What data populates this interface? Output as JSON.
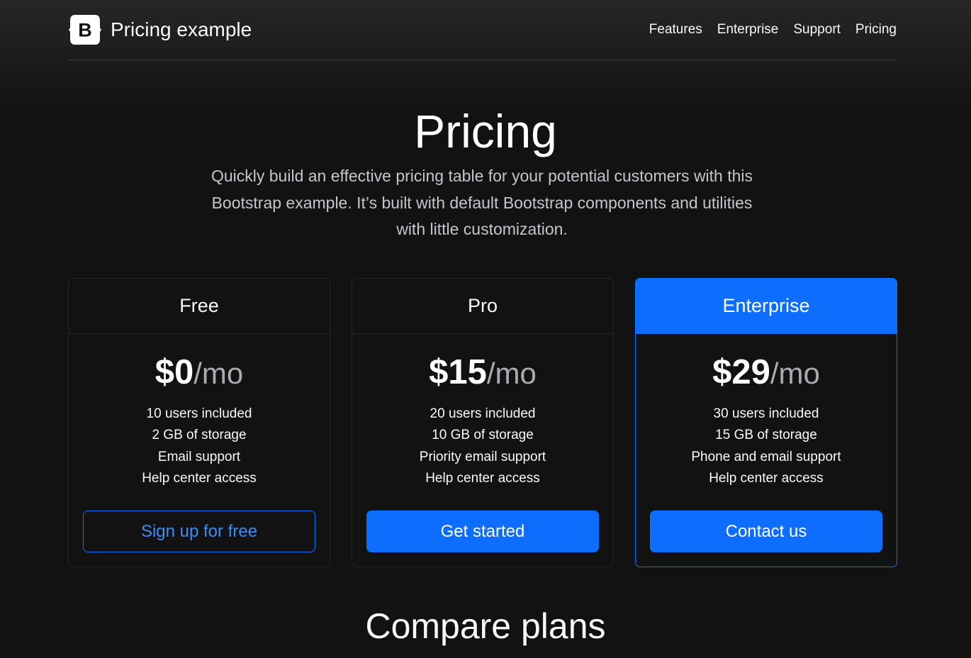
{
  "header": {
    "brand": "Pricing example",
    "logo_letter": "B",
    "nav": [
      "Features",
      "Enterprise",
      "Support",
      "Pricing"
    ]
  },
  "hero": {
    "title": "Pricing",
    "lead": "Quickly build an effective pricing table for your potential customers with this Bootstrap example. It’s built with default Bootstrap components and utilities with little customization."
  },
  "plans": [
    {
      "name": "Free",
      "amount": "$0",
      "per": "/mo",
      "features": [
        "10 users included",
        "2 GB of storage",
        "Email support",
        "Help center access"
      ],
      "button": "Sign up for free"
    },
    {
      "name": "Pro",
      "amount": "$15",
      "per": "/mo",
      "features": [
        "20 users included",
        "10 GB of storage",
        "Priority email support",
        "Help center access"
      ],
      "button": "Get started"
    },
    {
      "name": "Enterprise",
      "amount": "$29",
      "per": "/mo",
      "features": [
        "30 users included",
        "15 GB of storage",
        "Phone and email support",
        "Help center access"
      ],
      "button": "Contact us"
    }
  ],
  "compare": {
    "title": "Compare plans"
  },
  "colors": {
    "accent": "#0d6efd",
    "background": "#121212"
  }
}
